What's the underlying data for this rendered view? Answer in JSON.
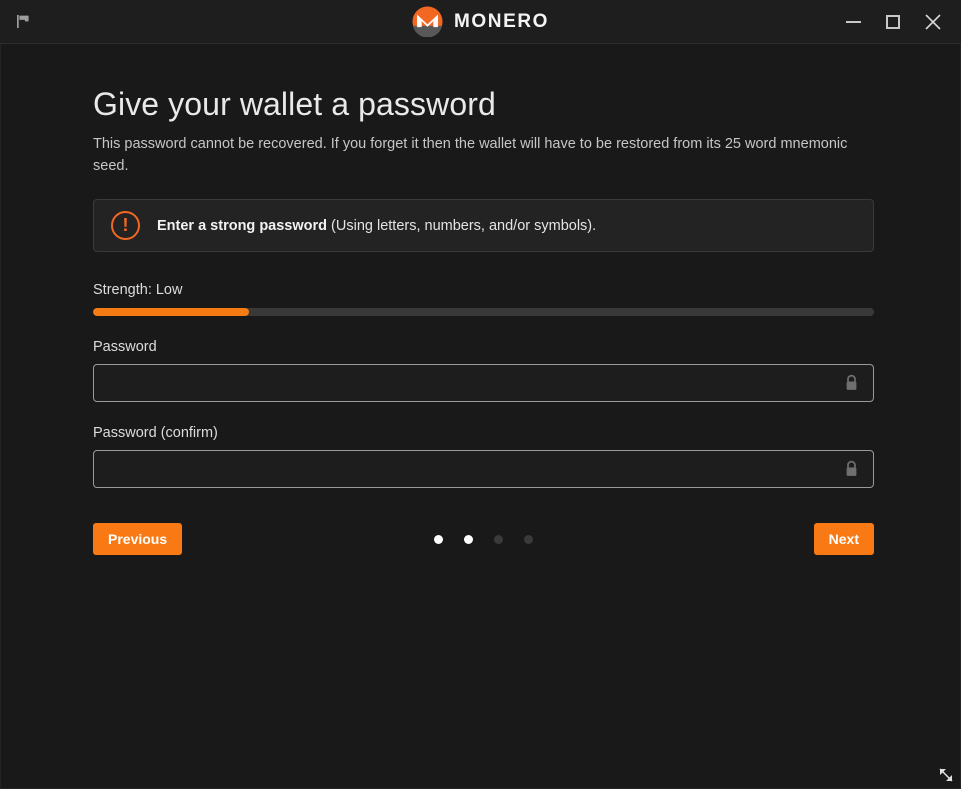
{
  "window": {
    "brand": "MONERO",
    "flag_icon": "flag-icon",
    "logo_icon": "monero-logo-icon",
    "minimize_label": "",
    "maximize_label": "",
    "close_label": "✕"
  },
  "page": {
    "title": "Give your wallet a password",
    "subtitle": "This password cannot be recovered. If you forget it then the wallet will have to be restored from its 25 word mnemonic seed."
  },
  "warning": {
    "icon": "exclamation-circle-icon",
    "bold_text": "Enter a strong password",
    "rest_text": " (Using letters, numbers, and/or symbols).",
    "accent_color": "#f26822"
  },
  "strength": {
    "label": "Strength: Low",
    "percent": 20,
    "fill_color": "#f57c13",
    "track_color": "#393939"
  },
  "fields": {
    "password": {
      "label": "Password",
      "value": "",
      "placeholder": "",
      "icon": "lock-icon"
    },
    "password_confirm": {
      "label": "Password (confirm)",
      "value": "",
      "placeholder": "",
      "icon": "lock-icon"
    }
  },
  "footer": {
    "previous_label": "Previous",
    "next_label": "Next",
    "button_color": "#f97a15",
    "steps": [
      {
        "active": true
      },
      {
        "active": true
      },
      {
        "active": false
      },
      {
        "active": false
      }
    ]
  }
}
